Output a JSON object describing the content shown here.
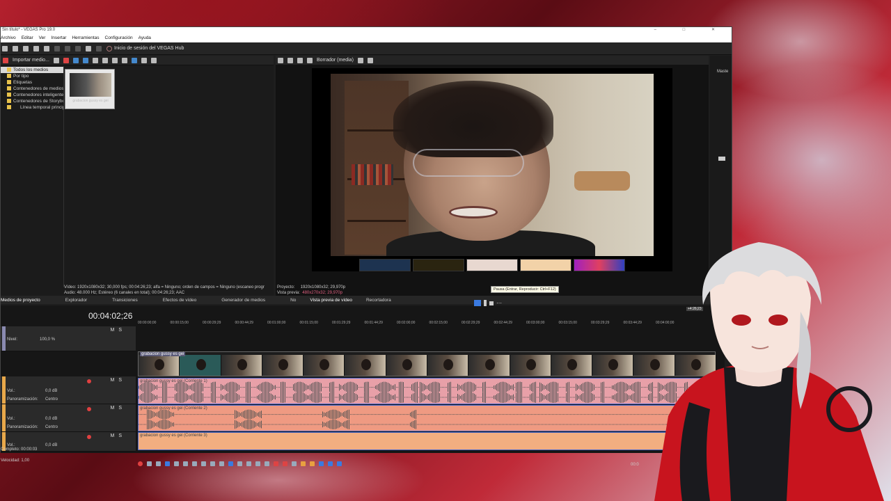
{
  "window": {
    "title": "Sin título* - VEGAS Pro 19.0",
    "controls": [
      "–",
      "□",
      "✕"
    ]
  },
  "menu": [
    "Archivo",
    "Editar",
    "Ver",
    "Insertar",
    "Herramientas",
    "Configuración",
    "Ayuda"
  ],
  "toolbar": {
    "hub_label": "Inicio de sesión del VEGAS Hub"
  },
  "media_panel": {
    "import_label": "Importar medio...",
    "tree": [
      {
        "label": "Todos los medios",
        "selected": true
      },
      {
        "label": "Por tipo",
        "selected": false
      },
      {
        "label": "Etiquetas",
        "selected": false
      },
      {
        "label": "Contenedores de medios",
        "selected": false
      },
      {
        "label": "Contenedores inteligentes",
        "selected": false
      },
      {
        "label": "Contenedores de Storyboard",
        "selected": false
      },
      {
        "label": "Línea temporal principal",
        "selected": false
      }
    ],
    "thumb_caption": "grabacion gussy es gei",
    "info_video": "Vídeo: 1920x1080x32; 30,000 fps; 00:04:26;23; alfa = Ninguno; orden de campos = Ninguno (escaneo progr",
    "info_audio": "Audio: 48.000 Hz; Estéreo (6 canales en total); 00:04:26;23; AAC"
  },
  "preview": {
    "toolbar_label": "Borrador (media)",
    "project_label": "Proyecto:",
    "project_value": "1920x1080x32; 29,970p",
    "preview_label": "Vista previa:",
    "preview_value": "480x270x32; 29,970p",
    "tooltip": "Pausa (Entrar, Reproducir: Ctrl+F12)"
  },
  "tabs": [
    "Medios de proyecto",
    "Explorador",
    "Transiciones",
    "Efectos de vídeo",
    "Generador de medios",
    "No",
    "Vista previa de vídeo",
    "Recortadora"
  ],
  "timeline": {
    "timecode": "00:04:02;26",
    "end_marker": "+4:26;23",
    "ruler": [
      "00:00:00;00",
      "00:00:15;00",
      "00:00:29;29",
      "00:00:44;29",
      "00:01:00;00",
      "00:01:15;00",
      "00:01:29;29",
      "00:01:44;29",
      "00:02:00;00",
      "00:02:15;00",
      "00:02:29;29",
      "00:02:44;29",
      "00:03:00;00",
      "00:03:15;00",
      "00:03:29;29",
      "00:03:44;29",
      "00:04:00;00"
    ],
    "video_track": {
      "level_label": "Nivel:",
      "level_value": "100,0 %",
      "clip_name": "grabacion gussy es gei"
    },
    "audio_tracks": [
      {
        "vol_label": "Vol.:",
        "vol_value": "0,0 dB",
        "pan_label": "Panoramización:",
        "pan_value": "Centro",
        "clip_name": "grabacion gussy es gei (Corriente 1)",
        "color": "#e8a0a8"
      },
      {
        "vol_label": "Vol.:",
        "vol_value": "0,0 dB",
        "pan_label": "Panoramización:",
        "pan_value": "Centro",
        "clip_name": "grabacion gussy es gei (Corriente 2)",
        "color": "#ef9a82"
      },
      {
        "vol_label": "Vol.:",
        "vol_value": "0,0 dB",
        "pan_label": "",
        "pan_value": "",
        "clip_name": "grabacion gussy es gei (Corriente 3)",
        "color": "#f2ae80"
      }
    ],
    "speed_label": "Velocidad: 1,00",
    "end_time": "00:0"
  },
  "status": "Completo: 00:00:03",
  "master_label": "Maste"
}
